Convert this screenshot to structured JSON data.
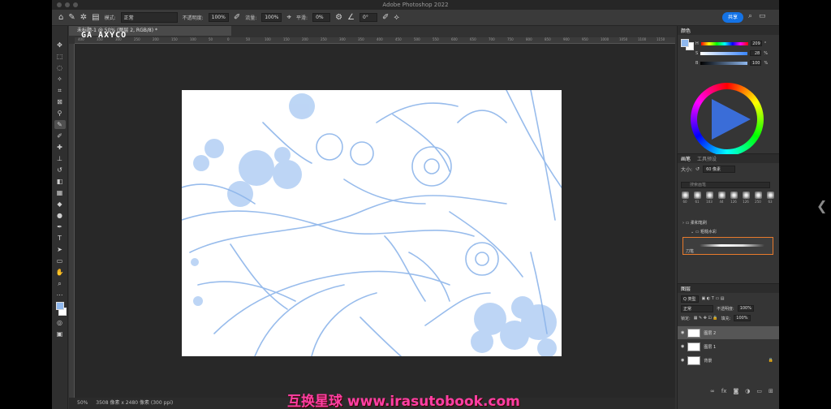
{
  "window": {
    "title": "Adobe Photoshop 2022"
  },
  "options_bar": {
    "mode_label": "模式:",
    "mode_value": "正常",
    "opacity_label": "不透明度:",
    "opacity_value": "100%",
    "flow_label": "流量:",
    "flow_value": "100%",
    "smoothing_label": "平滑:",
    "smoothing_value": "0%",
    "angle_value": "0°",
    "share_label": "共享"
  },
  "document": {
    "tab_label": "未标题-1 @ 50% (图层 2, RGB/8) *",
    "overlay_text": "GA AXYCO"
  },
  "ruler": {
    "ticks": [
      "400",
      "350",
      "300",
      "250",
      "200",
      "150",
      "100",
      "50",
      "0",
      "50",
      "100",
      "150",
      "200",
      "250",
      "300",
      "350",
      "400",
      "450",
      "500",
      "550",
      "600",
      "650",
      "700",
      "750",
      "800",
      "850",
      "900",
      "950",
      "1000",
      "1050",
      "1100",
      "1150"
    ]
  },
  "status": {
    "zoom": "50%",
    "doc_size": "3508 像素 x 2480 像素 (300 ppi)"
  },
  "color_panel": {
    "tab": "颜色",
    "h_label": "H",
    "h_value": "209",
    "s_label": "S",
    "s_value": "28",
    "b_label": "B",
    "b_value": "100",
    "unit_deg": "°",
    "unit_pct": "%",
    "foreground": "#8fb8ee"
  },
  "brush_panel": {
    "tab_brush": "画笔",
    "tab_presets": "工具预设",
    "size_label": "大小:",
    "size_value": "60 像素",
    "search_placeholder": "搜索画笔",
    "presets": [
      "60",
      "61",
      "103",
      "44",
      "126",
      "126",
      "250",
      "63"
    ],
    "group_1": "柔和笔刷",
    "group_2": "粗糙水彩",
    "stroke_name": "刀笔"
  },
  "layers_panel": {
    "tab": "图层",
    "filter": "Q 类型",
    "blend": "正常",
    "opacity_label": "不透明度:",
    "opacity_value": "100%",
    "lock_label": "锁定:",
    "fill_label": "填充:",
    "fill_value": "100%",
    "layers": [
      {
        "name": "图层 2"
      },
      {
        "name": "图层 1"
      },
      {
        "name": "背景"
      }
    ]
  },
  "bottom_watermark": "互换星球 www.irasutobook.com"
}
